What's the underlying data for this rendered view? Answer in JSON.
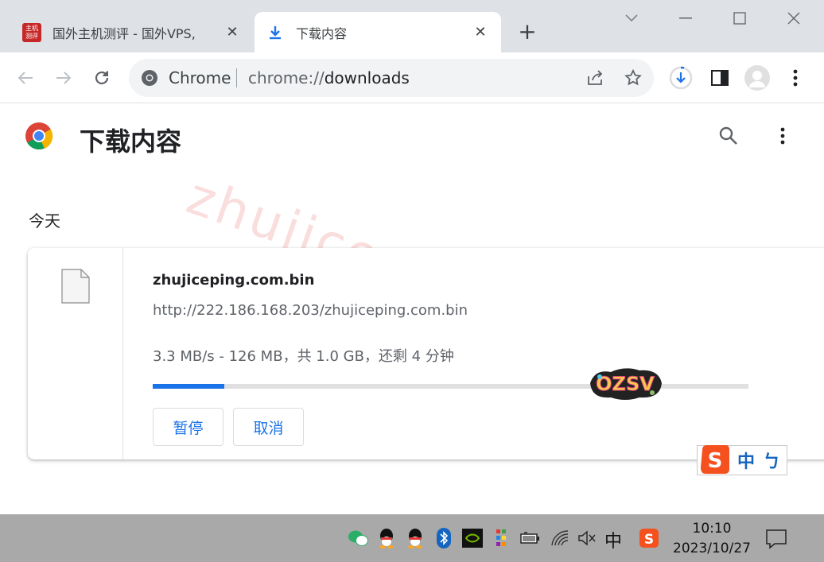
{
  "tabs": [
    {
      "title": "国外主机测评 - 国外VPS,",
      "favicon": "site-logo-icon",
      "active": false
    },
    {
      "title": "下载内容",
      "favicon": "download-icon",
      "active": true
    }
  ],
  "favicon_text": "主机测评",
  "omnibox": {
    "chip": "Chrome",
    "url_scheme": "chrome://",
    "url_path": "downloads"
  },
  "page": {
    "title": "下载内容",
    "day_label": "今天",
    "watermark": "zhujiceping.com"
  },
  "download": {
    "filename": "zhujiceping.com.bin",
    "url": "http://222.186.168.203/zhujiceping.com.bin",
    "status": "3.3 MB/s - 126 MB，共 1.0 GB，还剩 4 分钟",
    "progress_percent": 12,
    "pause_label": "暂停",
    "cancel_label": "取消"
  },
  "sticker_text": "OZSV",
  "ime": {
    "label": "中",
    "pin": "ㄅ"
  },
  "taskbar": {
    "ime_label": "中",
    "time": "10:10",
    "date": "2023/10/27"
  },
  "colors": {
    "accent": "#1a73e8",
    "tabstrip": "#dee1e6",
    "taskbar": "#a9a9a9"
  }
}
